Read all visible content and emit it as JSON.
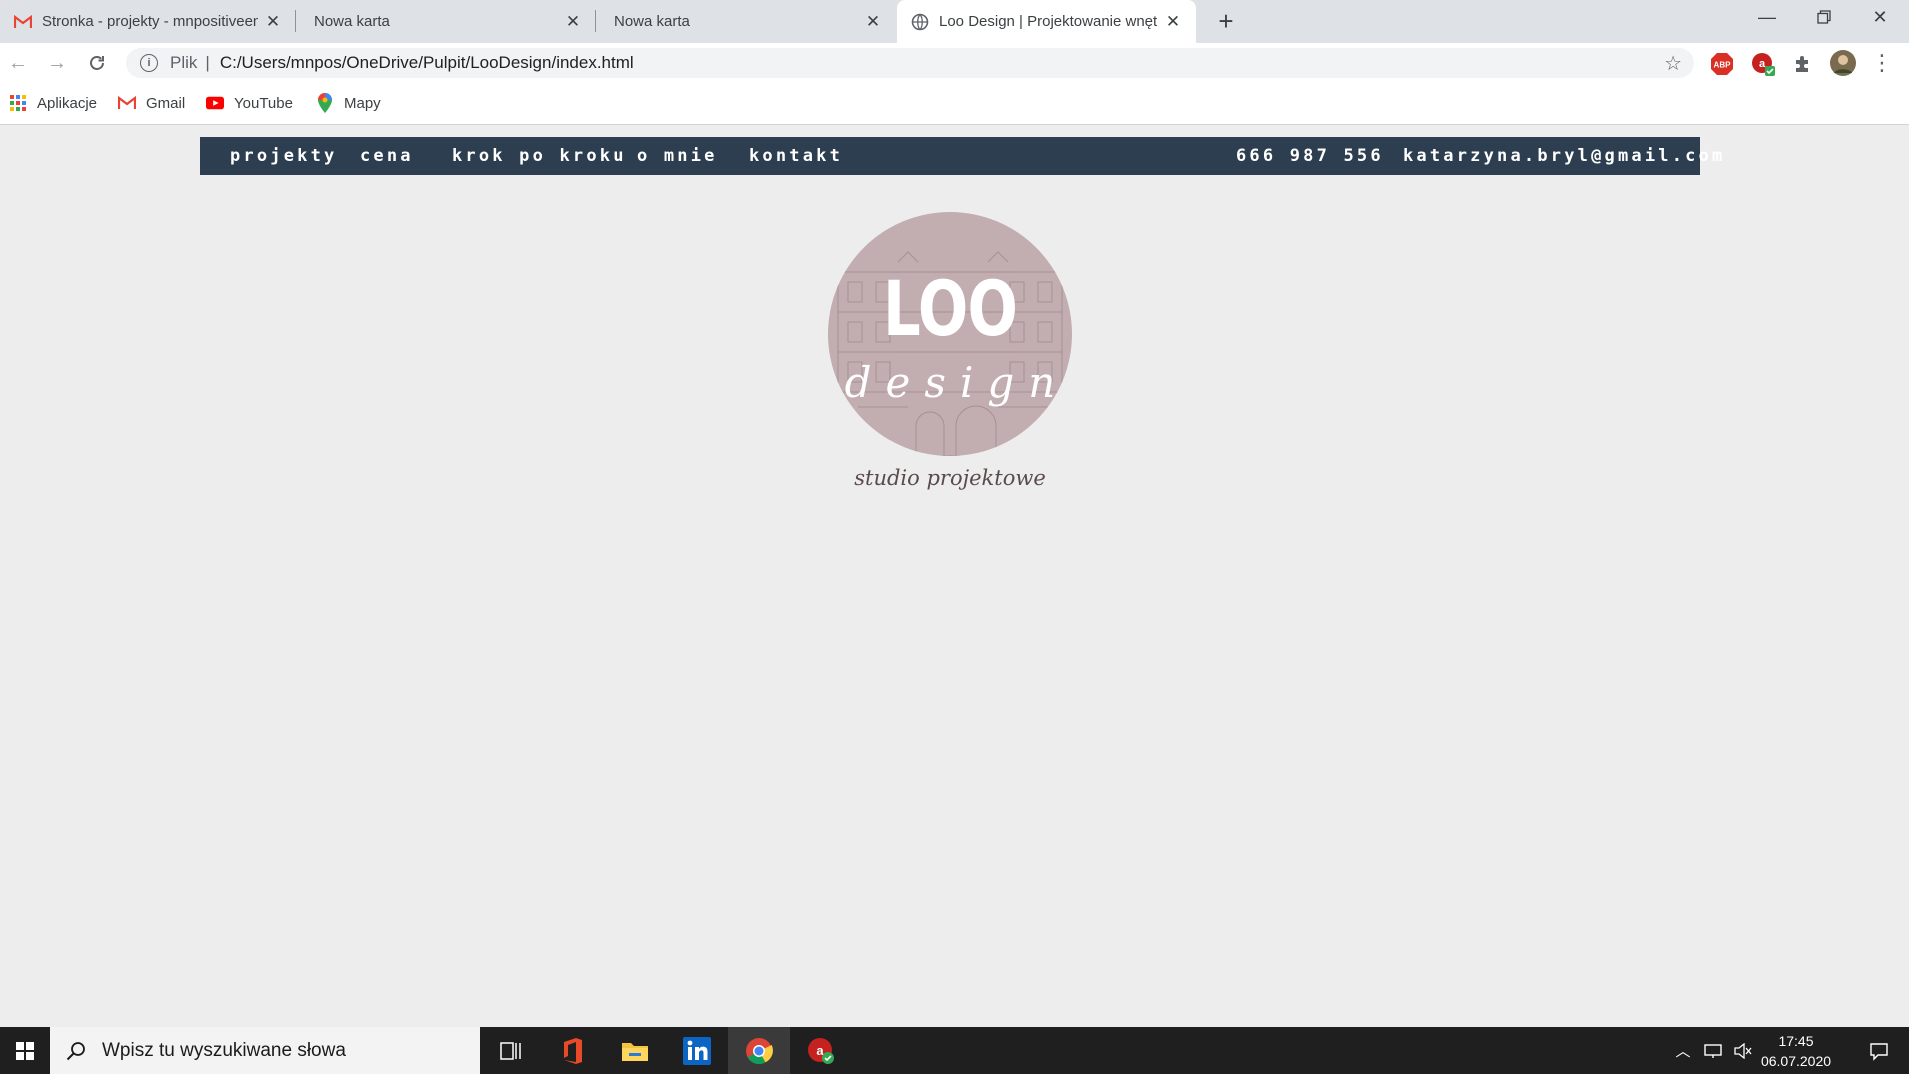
{
  "browser": {
    "tabs": [
      {
        "title": "Stronka - projekty - mnpositiveen",
        "icon": "gmail-icon",
        "active": false
      },
      {
        "title": "Nowa karta",
        "icon": "",
        "active": false
      },
      {
        "title": "Nowa karta",
        "icon": "",
        "active": false
      },
      {
        "title": "Loo Design | Projektowanie wnętrz",
        "icon": "globe-icon",
        "active": true
      }
    ],
    "address": {
      "scheme": "Plik",
      "url": "C:/Users/mnpos/OneDrive/Pulpit/LooDesign/index.html"
    },
    "extensions": [
      "adblock-icon",
      "extension-red-icon",
      "puzzle-icon",
      "profile-avatar"
    ],
    "bookmarks": [
      {
        "label": "Aplikacje",
        "icon": "apps-grid-icon"
      },
      {
        "label": "Gmail",
        "icon": "gmail-icon"
      },
      {
        "label": "YouTube",
        "icon": "youtube-icon"
      },
      {
        "label": "Mapy",
        "icon": "maps-pin-icon"
      }
    ]
  },
  "site": {
    "nav": {
      "links": [
        "projekty",
        "cena",
        "krok po kroku",
        "o mnie",
        "kontakt"
      ],
      "phone": "666 987 556",
      "email": "katarzyna.bryl@gmail.com"
    },
    "logo": {
      "main": "LOO",
      "sub": "design",
      "tagline": "studio projektowe"
    },
    "colors": {
      "nav_bg": "#2c3e50",
      "logo_circle": "#c2adb0",
      "page_bg": "#ededed"
    }
  },
  "taskbar": {
    "search_placeholder": "Wpisz tu wyszukiwane słowa",
    "apps": [
      "task-view-icon",
      "office-icon",
      "file-explorer-icon",
      "linkedin-icon",
      "chrome-icon",
      "antivirus-icon"
    ],
    "time": "17:45",
    "date": "06.07.2020"
  }
}
